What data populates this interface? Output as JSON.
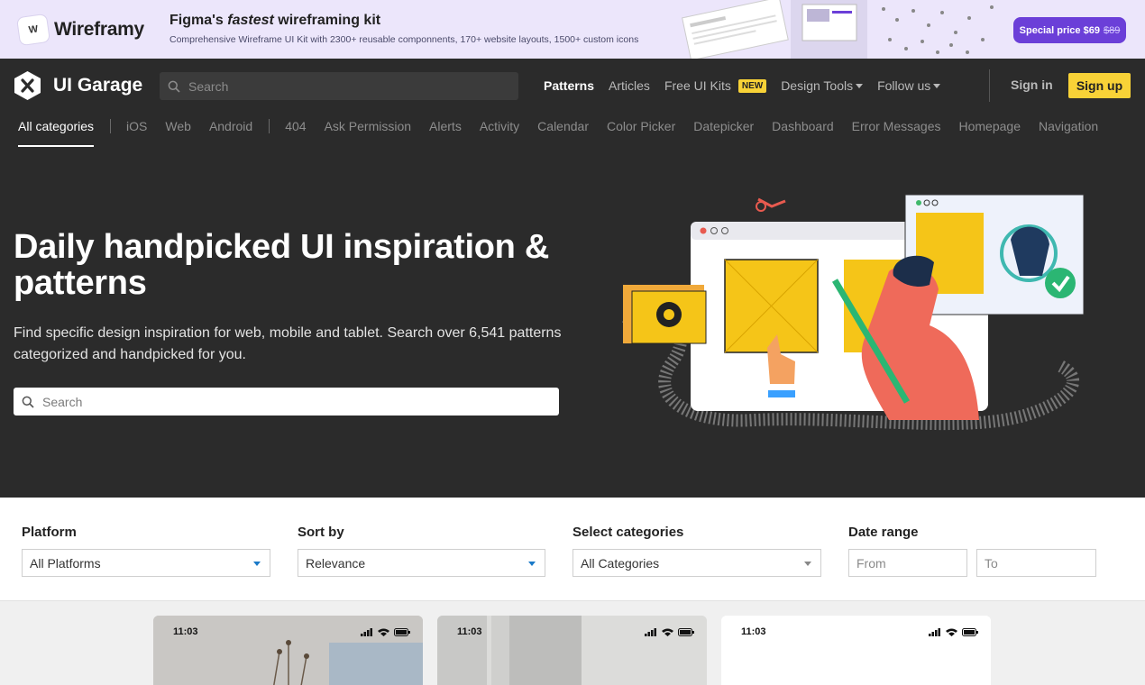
{
  "promo": {
    "brand": "Wireframy",
    "brand_mark": "W",
    "title_pre": "Figma's ",
    "title_em": "fastest",
    "title_post": " wireframing kit",
    "subtitle": "Comprehensive Wireframe UI Kit with 2300+ reusable componnents, 170+ website layouts, 1500+ custom icons",
    "cta_label": "Special price $69",
    "cta_old_price": "$89"
  },
  "nav": {
    "brand": "UI Garage",
    "search_placeholder": "Search",
    "links": {
      "patterns": "Patterns",
      "articles": "Articles",
      "free_kits": "Free UI Kits",
      "new_badge": "NEW",
      "design_tools": "Design Tools",
      "follow_us": "Follow us"
    },
    "sign_in": "Sign in",
    "sign_up": "Sign up"
  },
  "categories": {
    "all": "All categories",
    "platforms": [
      "iOS",
      "Web",
      "Android"
    ],
    "items": [
      "404",
      "Ask Permission",
      "Alerts",
      "Activity",
      "Calendar",
      "Color Picker",
      "Datepicker",
      "Dashboard",
      "Error Messages",
      "Homepage",
      "Navigation"
    ]
  },
  "hero": {
    "title": "Daily handpicked UI inspiration & patterns",
    "description": "Find specific design inspiration for web, mobile and tablet. Search over 6,541 patterns categorized and handpicked for you.",
    "search_placeholder": "Search"
  },
  "filters": {
    "platform": {
      "label": "Platform",
      "value": "All Platforms"
    },
    "sort": {
      "label": "Sort by",
      "value": "Relevance"
    },
    "categories": {
      "label": "Select categories",
      "value": "All Categories"
    },
    "date": {
      "label": "Date range",
      "from_placeholder": "From",
      "to_placeholder": "To"
    }
  },
  "results": {
    "cards": [
      {
        "time": "11:03"
      },
      {
        "time": "11:03"
      },
      {
        "time": "11:03"
      }
    ]
  },
  "colors": {
    "dark_bg": "#2b2b2b",
    "accent_yellow": "#f8d237",
    "promo_bg": "#ece6fb",
    "promo_cta": "#6b3fd8"
  }
}
